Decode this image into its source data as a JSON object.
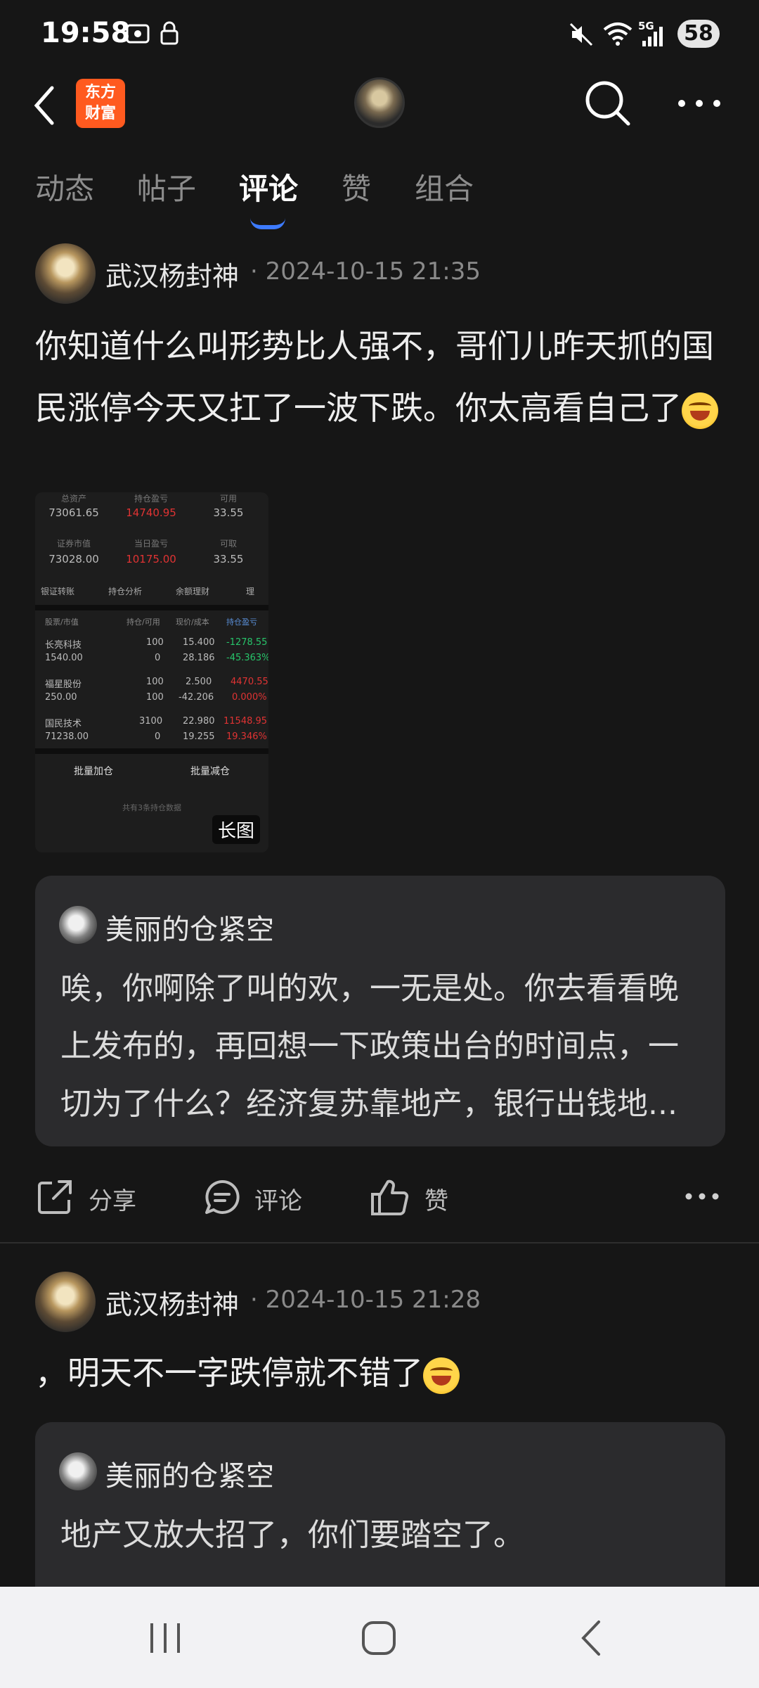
{
  "status_bar": {
    "time": "19:58",
    "battery": "58",
    "network": "5G"
  },
  "header": {
    "logo_line1": "东方",
    "logo_line2": "财富"
  },
  "tabs": [
    "动态",
    "帖子",
    "评论",
    "赞",
    "组合"
  ],
  "active_tab": "评论",
  "posts": [
    {
      "author": "武汉杨封神",
      "timestamp": "· 2024-10-15 21:35",
      "text": "你知道什么叫形势比人强不，哥们儿昨天抓的国民涨停今天又扛了一波下跌。你太高看自己了",
      "image": {
        "summary_labels": [
          "总资产",
          "持仓盈亏",
          "可用",
          "证券市值",
          "当日盈亏",
          "可取"
        ],
        "summary_values": [
          "73061.65",
          "14740.95",
          "33.55",
          "73028.00",
          "10175.00",
          "33.55"
        ],
        "menu": [
          "银证转账",
          "持仓分析",
          "余额理财",
          "理"
        ],
        "columns": [
          "股票/市值",
          "持仓/可用",
          "现价/成本",
          "持仓盈亏"
        ],
        "rows": [
          {
            "name": "长亮科技",
            "value": "1540.00",
            "hold": "100",
            "avail": "0",
            "price": "15.400",
            "cost": "28.186",
            "pl": "-1278.55",
            "pl_pct": "-45.363%"
          },
          {
            "name": "福星股份",
            "value": "250.00",
            "hold": "100",
            "avail": "100",
            "price": "2.500",
            "cost": "-42.206",
            "pl": "4470.55",
            "pl_pct": "0.000%"
          },
          {
            "name": "国民技术",
            "value": "71238.00",
            "hold": "3100",
            "avail": "0",
            "price": "22.980",
            "cost": "19.255",
            "pl": "11548.95",
            "pl_pct": "19.346%"
          }
        ],
        "buttons": [
          "批量加仓",
          "批量减仓"
        ],
        "footer": "共有3条持仓数据",
        "tag": "长图"
      },
      "quote": {
        "author": "美丽的仓紧空",
        "text": "唉，你啊除了叫的欢，一无是处。你去看看晚上发布的，再回想一下政策出台的时间点，一切为了什么？经济复苏靠地产，银行出钱地..."
      },
      "actions": {
        "share": "分享",
        "comment": "评论",
        "like": "赞"
      }
    },
    {
      "author": "武汉杨封神",
      "timestamp": "· 2024-10-15 21:28",
      "text": "，明天不一字跌停就不错了",
      "quote": {
        "author": "美丽的仓紧空",
        "text": "地产又放大招了，你们要踏空了。"
      }
    }
  ]
}
